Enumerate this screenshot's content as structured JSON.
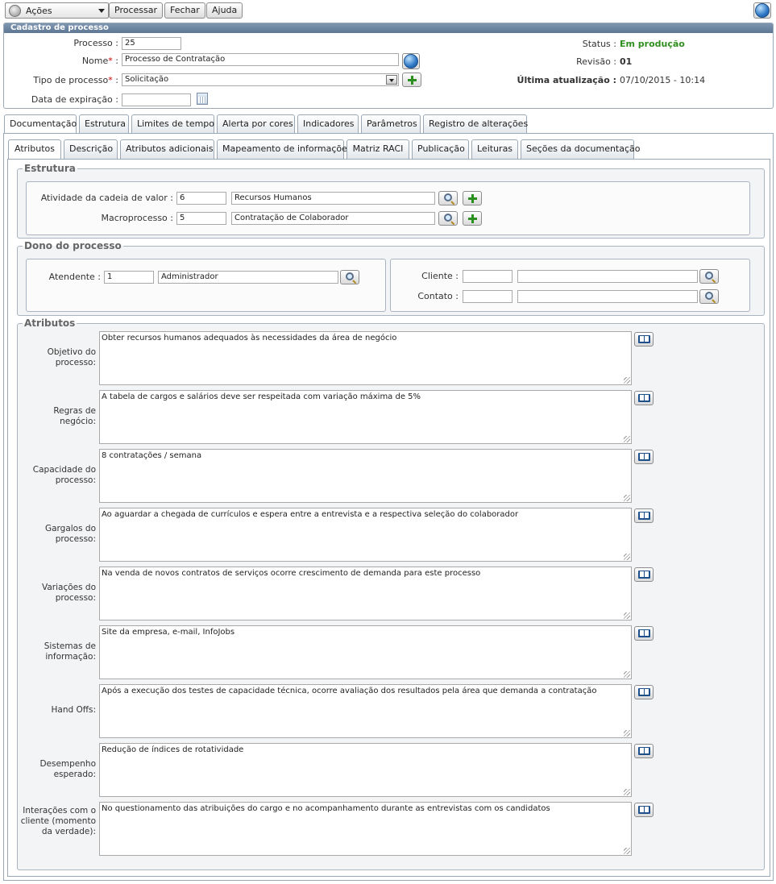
{
  "toolbar": {
    "actions_label": "Ações",
    "process_label": "Processar",
    "close_label": "Fechar",
    "help_label": "Ajuda"
  },
  "header": {
    "title": "Cadastro de processo",
    "fields": {
      "processo_label": "Processo :",
      "processo_value": "25",
      "nome_label": "Nome",
      "nome_value": "Processo de Contratação",
      "tipo_label": "Tipo de processo",
      "tipo_value": "Solicitação",
      "expiracao_label": "Data de expiração :",
      "expiracao_value": ""
    },
    "status": {
      "status_label": "Status :",
      "status_value": "Em produção",
      "status_color": "#2f8f1f",
      "revisao_label": "Revisão :",
      "revisao_value": "01",
      "atualizacao_label": "Última atualização :",
      "atualizacao_value": "07/10/2015 - 10:14"
    },
    "required_mark": "*",
    "colon": ":"
  },
  "main_tabs": [
    {
      "label": "Documentação",
      "active": true
    },
    {
      "label": "Estrutura"
    },
    {
      "label": "Limites de tempo"
    },
    {
      "label": "Alerta por cores"
    },
    {
      "label": "Indicadores"
    },
    {
      "label": "Parâmetros"
    },
    {
      "label": "Registro de alterações"
    }
  ],
  "sub_tabs": [
    {
      "label": "Atributos",
      "active": true
    },
    {
      "label": "Descrição"
    },
    {
      "label": "Atributos adicionais"
    },
    {
      "label": "Mapeamento de informações"
    },
    {
      "label": "Matriz RACI"
    },
    {
      "label": "Publicação"
    },
    {
      "label": "Leituras"
    },
    {
      "label": "Seções da documentação"
    }
  ],
  "estrutura": {
    "legend": "Estrutura",
    "atividade_label": "Atividade da cadeia de valor :",
    "atividade_code": "6",
    "atividade_name": "Recursos Humanos",
    "macro_label": "Macroprocesso :",
    "macro_code": "5",
    "macro_name": "Contratação de Colaborador"
  },
  "dono": {
    "legend": "Dono do processo",
    "atendente_label": "Atendente :",
    "atendente_code": "1",
    "atendente_name": "Administrador",
    "cliente_label": "Cliente :",
    "cliente_code": "",
    "cliente_name": "",
    "contato_label": "Contato :",
    "contato_code": "",
    "contato_name": ""
  },
  "atributos": {
    "legend": "Atributos",
    "items": [
      {
        "label": "Objetivo do processo:",
        "value": "Obter recursos humanos adequados às necessidades da área de negócio"
      },
      {
        "label": "Regras de negócio:",
        "value": "A tabela de cargos e salários deve ser respeitada com variação máxima de 5%"
      },
      {
        "label": "Capacidade do processo:",
        "value": "8 contratações / semana"
      },
      {
        "label": "Gargalos do processo:",
        "value": "Ao aguardar a chegada de currículos e espera entre a entrevista e a respectiva seleção do colaborador"
      },
      {
        "label": "Variações do processo:",
        "value": "Na venda de novos contratos de serviços ocorre crescimento de demanda para este processo"
      },
      {
        "label": "Sistemas de informação:",
        "value": "Site da empresa, e-mail, InfoJobs"
      },
      {
        "label": "Hand Offs:",
        "value": "Após a execução dos testes de capacidade técnica, ocorre avaliação dos resultados pela área que demanda a contratação"
      },
      {
        "label": "Desempenho esperado:",
        "value": "Redução de índices de rotatividade"
      },
      {
        "label": "Interações com o cliente (momento da verdade):",
        "value": "No questionamento das atribuições do cargo e no acompanhamento durante as entrevistas com os candidatos"
      }
    ]
  }
}
